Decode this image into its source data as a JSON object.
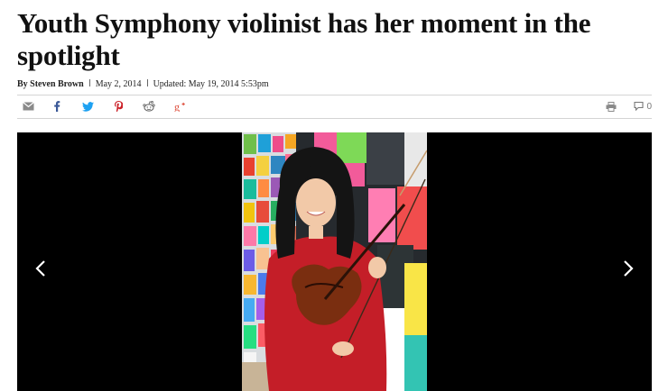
{
  "article": {
    "headline": "Youth Symphony violinist has her moment in the spotlight",
    "byline": {
      "author": "By Steven Brown",
      "date": "May 2, 2014",
      "updated": "Updated: May 19, 2014 5:53pm"
    }
  },
  "share_bar": {
    "icons": [
      "email-icon",
      "facebook-icon",
      "twitter-icon",
      "pinterest-icon",
      "reddit-icon",
      "google-plus-icon",
      "print-icon",
      "comment-icon"
    ],
    "comment_count": "0"
  },
  "gallery": {
    "prev_icon": "chevron-left-icon",
    "next_icon": "chevron-right-icon"
  },
  "colors": {
    "headline": "#111111",
    "share_icon_gray": "#8a8a8a",
    "facebook": "#3b5998",
    "twitter": "#1da1f2",
    "pinterest": "#cb2027",
    "google_plus": "#dd4b39",
    "gallery_bg": "#000000"
  }
}
